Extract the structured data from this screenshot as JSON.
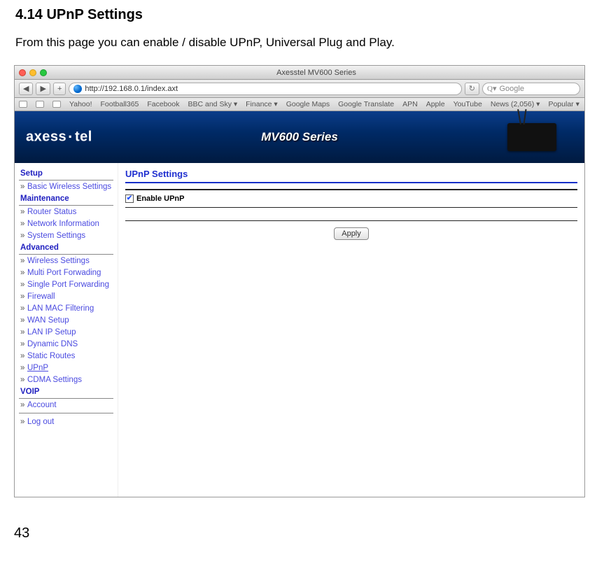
{
  "doc": {
    "heading": "4.14  UPnP Settings",
    "text": "From this page you can enable / disable UPnP, Universal Plug and Play.",
    "page_number": "43"
  },
  "window": {
    "title": "Axesstel MV600 Series",
    "url": "http://192.168.0.1/index.axt",
    "search_placeholder": "Google",
    "reload_glyph": "↻"
  },
  "bookmarks": [
    "Yahoo!",
    "Football365",
    "Facebook",
    "BBC and Sky ▾",
    "Finance ▾",
    "Google Maps",
    "Google Translate",
    "APN",
    "Apple",
    "YouTube",
    "News (2,056) ▾",
    "Popular ▾"
  ],
  "banner": {
    "brand_left": "axess",
    "brand_right": "tel",
    "series": "MV600 Series"
  },
  "nav": {
    "setup": "Setup",
    "basic_wireless": "Basic Wireless Settings",
    "maintenance": "Maintenance",
    "router_status": "Router Status",
    "network_info": "Network Information",
    "system_settings": "System Settings",
    "advanced": "Advanced",
    "wireless_settings": "Wireless Settings",
    "multi_port": "Multi Port Forwading",
    "single_port": "Single Port Forwarding",
    "firewall": "Firewall",
    "lan_mac": "LAN MAC Filtering",
    "wan_setup": "WAN Setup",
    "lan_ip": "LAN IP Setup",
    "ddns": "Dynamic DNS",
    "static_routes": "Static Routes",
    "upnp": "UPnP",
    "cdma": "CDMA Settings",
    "voip": "VOIP",
    "account": "Account",
    "logout": "Log out"
  },
  "panel": {
    "title": "UPnP Settings",
    "checkbox_label": "Enable UPnP",
    "checked": "✔",
    "apply": "Apply"
  }
}
